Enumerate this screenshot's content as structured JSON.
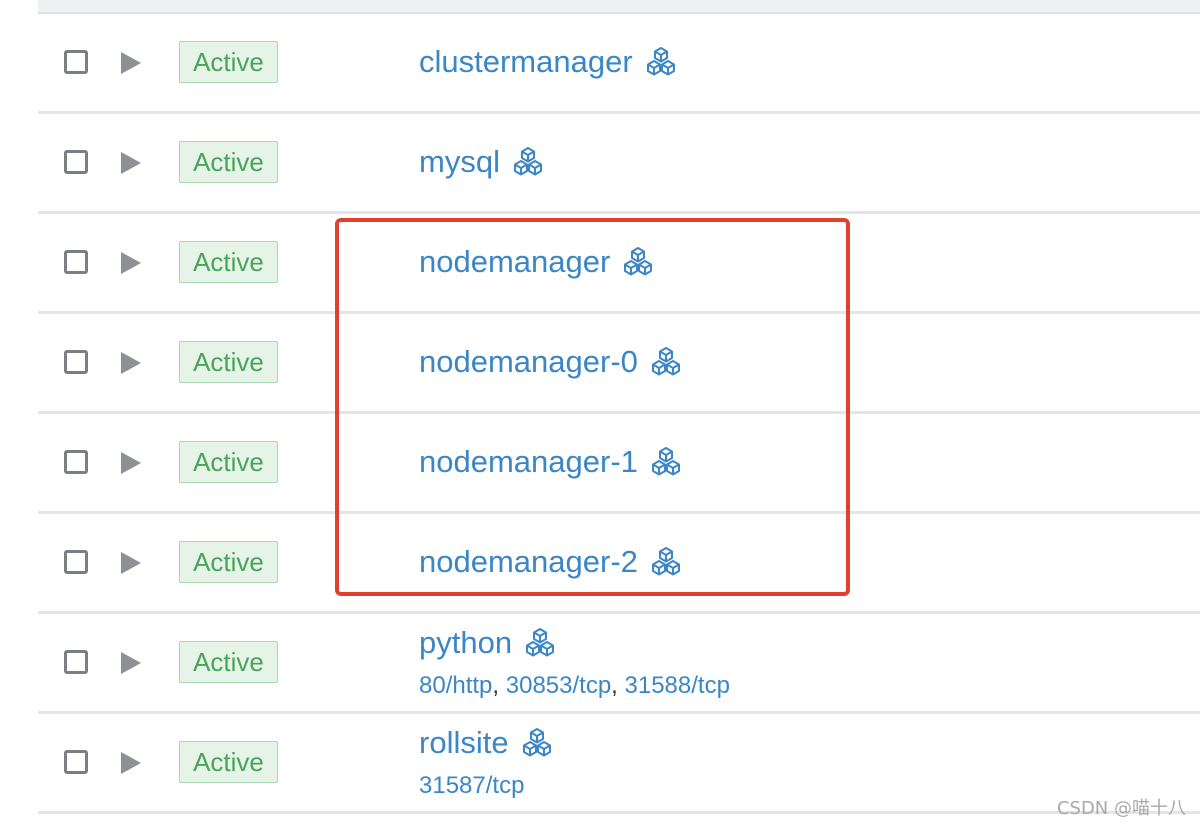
{
  "status_label": "Active",
  "accent_color": "#3b86c7",
  "status_color": "#4aa35b",
  "highlight_color": "#e0402e",
  "rows": [
    {
      "name": "clustermanager",
      "icon": "stack-cubes-icon",
      "ports": []
    },
    {
      "name": "mysql",
      "icon": "stack-cubes-icon",
      "ports": []
    },
    {
      "name": "nodemanager",
      "icon": "stack-cubes-icon",
      "ports": []
    },
    {
      "name": "nodemanager-0",
      "icon": "stack-cubes-icon",
      "ports": []
    },
    {
      "name": "nodemanager-1",
      "icon": "stack-cubes-icon",
      "ports": []
    },
    {
      "name": "nodemanager-2",
      "icon": "stack-cubes-icon",
      "ports": []
    },
    {
      "name": "python",
      "icon": "stack-cubes-icon",
      "ports": [
        "80/http",
        "30853/tcp",
        "31588/tcp"
      ]
    },
    {
      "name": "rollsite",
      "icon": "stack-cubes-icon",
      "ports": [
        "31587/tcp"
      ]
    }
  ],
  "watermark": "CSDN @喵十八"
}
